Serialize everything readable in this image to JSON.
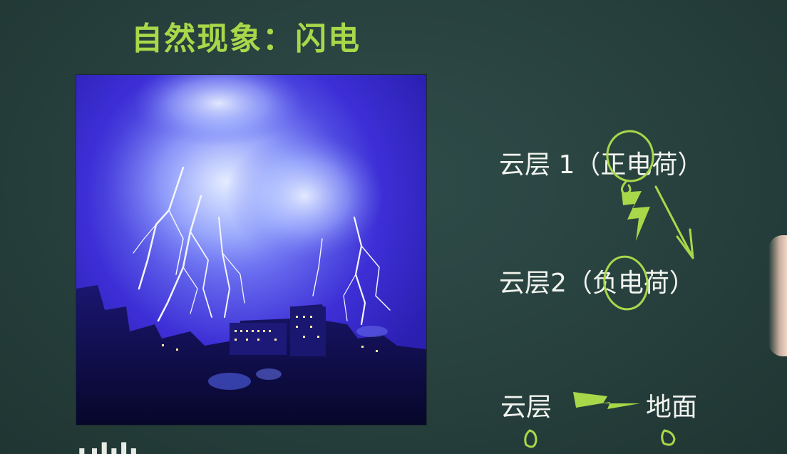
{
  "slide": {
    "title": "自然现象：闪电"
  },
  "photo": {
    "subject": "lightning over city at night"
  },
  "diagram": {
    "cloud1_label": "云层 1（正电荷）",
    "cloud2_label": "云层2（负电荷）",
    "bottom_cloud_label": "云层",
    "ground_label": "地面"
  },
  "colors": {
    "background": "#27403d",
    "title": "#a8d84a",
    "annotation": "#a8d84a",
    "text": "#f2f4ef"
  },
  "icons": {
    "lightning_bolt": "lightning-bolt-icon",
    "arrow": "arrow-down-icon"
  }
}
